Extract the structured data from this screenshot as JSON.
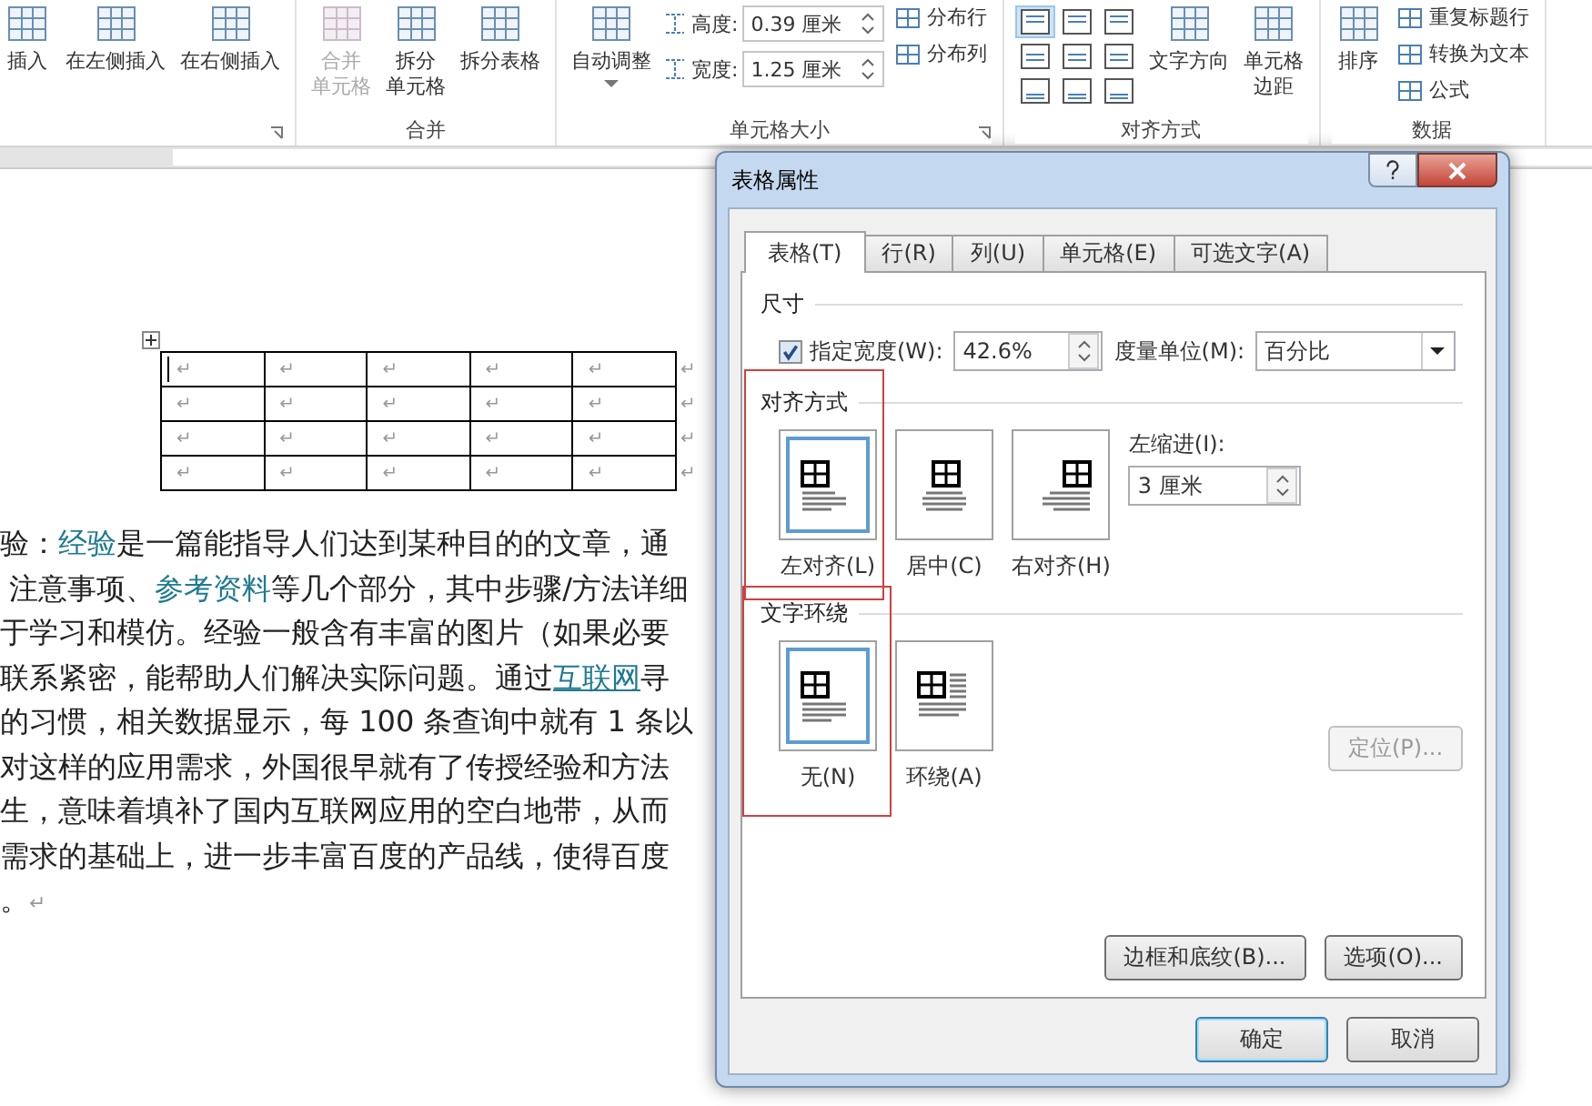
{
  "ribbon": {
    "groups": [
      {
        "launcher": true,
        "columns": [
          [
            {
              "kind": "large",
              "lines": [
                "插入"
              ],
              "disabled": false
            }
          ],
          [
            {
              "kind": "large",
              "lines": [
                "在左侧插入"
              ],
              "disabled": false
            }
          ],
          [
            {
              "kind": "large",
              "lines": [
                "在右侧插入"
              ],
              "disabled": false
            }
          ]
        ]
      },
      {
        "label": "合并",
        "columns": [
          [
            {
              "kind": "large",
              "lines": [
                "合并",
                "单元格"
              ],
              "disabled": true
            }
          ],
          [
            {
              "kind": "large",
              "lines": [
                "拆分",
                "单元格"
              ],
              "disabled": false
            }
          ],
          [
            {
              "kind": "large",
              "lines": [
                "拆分表格"
              ],
              "disabled": false
            }
          ]
        ]
      },
      {
        "label": "单元格大小",
        "launcher": true,
        "columns": [
          [
            {
              "kind": "large",
              "lines": [
                "自动调整"
              ],
              "disabled": false,
              "dropdown": true
            }
          ],
          [
            {
              "kind": "field",
              "label": "高度:",
              "value": "0.39 厘米"
            },
            {
              "kind": "field",
              "label": "宽度:",
              "value": "1.25 厘米"
            }
          ],
          [
            {
              "kind": "small",
              "label": "分布行"
            },
            {
              "kind": "small",
              "label": "分布列"
            }
          ]
        ]
      },
      {
        "label": "对齐方式",
        "columns": [
          [
            {
              "kind": "align",
              "cells": [
                {
                  "selected": true
                },
                {
                  "selected": false
                },
                {
                  "selected": false
                },
                {
                  "selected": false
                },
                {
                  "selected": false
                },
                {
                  "selected": false
                },
                {
                  "selected": false
                },
                {
                  "selected": false
                },
                {
                  "selected": false
                }
              ]
            }
          ],
          [
            {
              "kind": "large",
              "lines": [
                "文字方向"
              ],
              "disabled": false
            }
          ],
          [
            {
              "kind": "large",
              "lines": [
                "单元格",
                "边距"
              ],
              "disabled": false
            }
          ]
        ]
      },
      {
        "label": "数据",
        "columns": [
          [
            {
              "kind": "large",
              "lines": [
                "排序"
              ],
              "disabled": false
            }
          ],
          [
            {
              "kind": "small",
              "label": "重复标题行"
            },
            {
              "kind": "small",
              "label": "转换为文本"
            },
            {
              "kind": "small",
              "label": "公式"
            }
          ]
        ]
      }
    ]
  },
  "document": {
    "table": {
      "rows": [
        {
          "cells": [
            "↵",
            "↵",
            "↵",
            "↵",
            "↵"
          ],
          "end": "↵"
        },
        {
          "cells": [
            "↵",
            "↵",
            "↵",
            "↵",
            "↵"
          ],
          "end": "↵"
        },
        {
          "cells": [
            "↵",
            "↵",
            "↵",
            "↵",
            "↵"
          ],
          "end": "↵"
        },
        {
          "cells": [
            "↵",
            "↵",
            "↵",
            "↵",
            "↵"
          ],
          "end": "↵"
        }
      ]
    },
    "lines": [
      [
        {
          "kind": "text",
          "text": "验："
        },
        {
          "kind": "link",
          "text": "经验"
        },
        {
          "kind": "text",
          "text": "是一篇能指导人们达到某种目的的文章，通"
        }
      ],
      [
        {
          "kind": "text",
          "text": " 注意事项、"
        },
        {
          "kind": "link",
          "text": "参考资料"
        },
        {
          "kind": "text",
          "text": "等几个部分，其中步骤/方法详细"
        }
      ],
      [
        {
          "kind": "text",
          "text": "于学习和模仿。经验一般含有丰富的图片（如果必要"
        }
      ],
      [
        {
          "kind": "text",
          "text": "联系紧密，能帮助人们解决实际问题。通过"
        },
        {
          "kind": "hyperlink",
          "text": "互联网"
        },
        {
          "kind": "text",
          "text": "寻"
        }
      ],
      [
        {
          "kind": "text",
          "text": "的习惯，相关数据显示，每 100 条查询中就有 1 条以"
        }
      ],
      [
        {
          "kind": "text",
          "text": "对这样的应用需求，外国很早就有了传授经验和方法"
        }
      ],
      [
        {
          "kind": "text",
          "text": "生，意味着填补了国内互联网应用的空白地带，从而"
        }
      ],
      [
        {
          "kind": "text",
          "text": "需求的基础上，进一步丰富百度的产品线，使得百度"
        }
      ],
      [
        {
          "kind": "text",
          "text": "。"
        },
        {
          "kind": "mark",
          "text": "↵"
        }
      ]
    ]
  },
  "dialog": {
    "title": "表格属性",
    "tabs": [
      {
        "label": "表格(T)",
        "selected": true
      },
      {
        "label": "行(R)",
        "selected": false
      },
      {
        "label": "列(U)",
        "selected": false
      },
      {
        "label": "单元格(E)",
        "selected": false
      },
      {
        "label": "可选文字(A)",
        "selected": false
      }
    ],
    "size_section": {
      "heading": "尺寸",
      "width_check": {
        "label": "指定宽度(W):",
        "checked": true
      },
      "width_field": {
        "value": "42.6%"
      },
      "unit_label": "度量单位(M):",
      "unit_dropdown": {
        "value": "百分比"
      }
    },
    "alignment_section": {
      "heading": "对齐方式",
      "options": [
        {
          "label": "左对齐(L)",
          "selected": true
        },
        {
          "label": "居中(C)",
          "selected": false
        },
        {
          "label": "右对齐(H)",
          "selected": false
        }
      ],
      "indent_label": "左缩进(I):",
      "indent_field": {
        "value": "3 厘米"
      }
    },
    "wrapping_section": {
      "heading": "文字环绕",
      "options": [
        {
          "label": "无(N)",
          "selected": true
        },
        {
          "label": "环绕(A)",
          "selected": false
        }
      ],
      "position_button": {
        "label": "定位(P)...",
        "disabled": true
      }
    },
    "panel_buttons": [
      "边框和底纹(B)...",
      "选项(O)..."
    ],
    "buttons": [
      {
        "label": "确定",
        "default": true
      },
      {
        "label": "取消",
        "default": false
      }
    ]
  }
}
